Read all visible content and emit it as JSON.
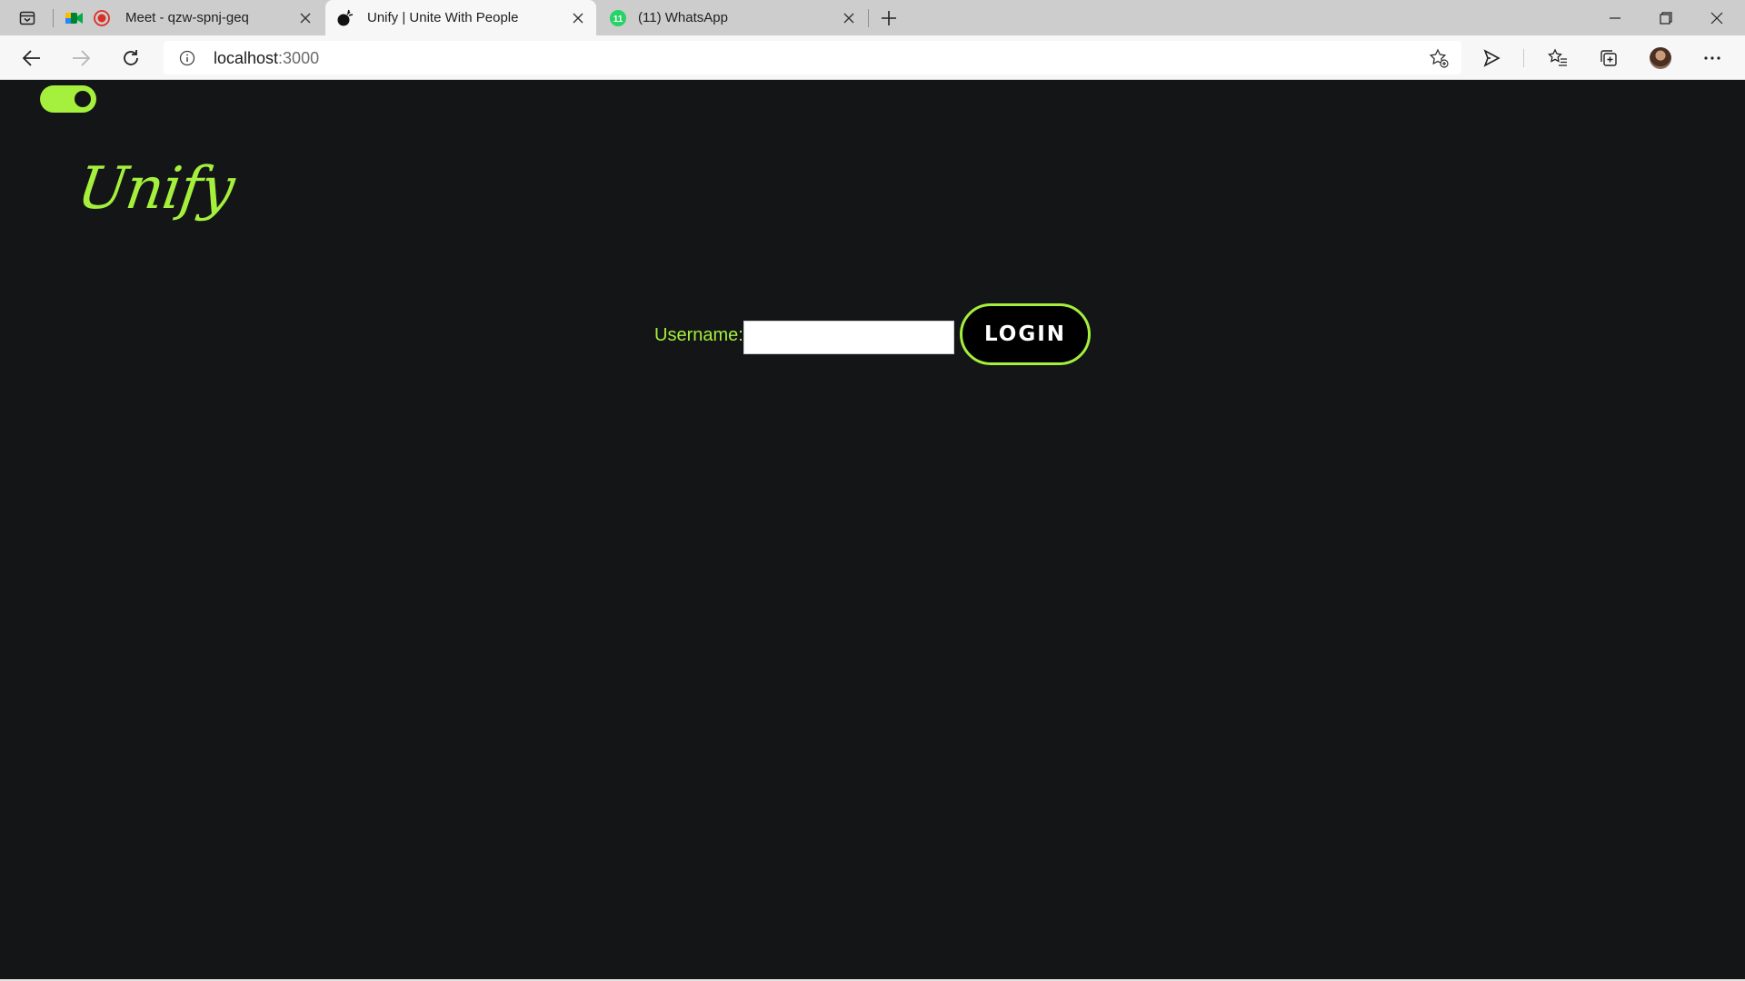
{
  "browser": {
    "tabs": [
      {
        "title": "Meet - qzw-spnj-geq",
        "icon": "google-meet-icon",
        "recording": true,
        "active": false
      },
      {
        "title": "Unify | Unite With People",
        "icon": "unify-favicon",
        "active": true
      },
      {
        "title": "(11) WhatsApp",
        "icon": "whatsapp-icon",
        "badge": "11",
        "active": false
      }
    ],
    "address_bar": {
      "host": "localhost",
      "port": ":3000"
    },
    "colors": {
      "tabstrip": "#cdcdcd",
      "toolbar": "#f7f7f7",
      "whatsapp_green": "#25d366",
      "meet_red": "#d93025"
    }
  },
  "page": {
    "theme_toggle": {
      "state": "on"
    },
    "logo_text": "Unify",
    "login": {
      "label": "Username:",
      "input_value": "",
      "button_label": "LOGIN"
    },
    "colors": {
      "background": "#141517",
      "accent": "#a4f03c",
      "button_bg": "#000000",
      "button_text": "#ffffff"
    }
  }
}
